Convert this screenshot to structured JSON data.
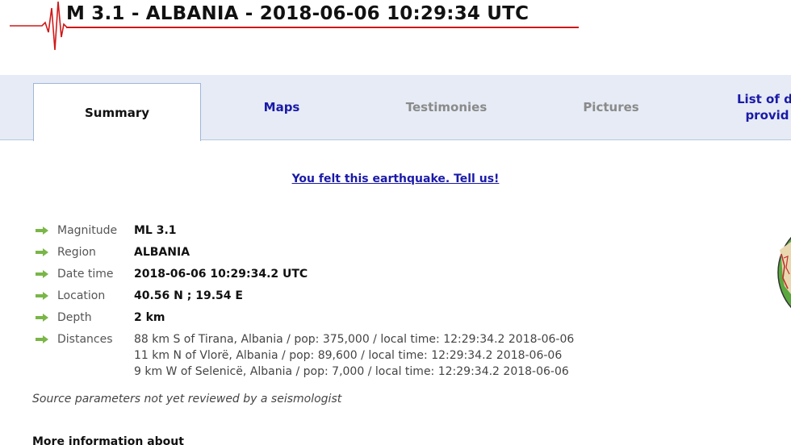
{
  "header": {
    "title": "M 3.1 - ALBANIA - 2018-06-06 10:29:34 UTC",
    "title_color": "#111111",
    "underline_color": "#d01818"
  },
  "tabs": [
    {
      "label": "Summary",
      "state": "active"
    },
    {
      "label": "Maps",
      "state": "link"
    },
    {
      "label": "Testimonies",
      "state": "disabled"
    },
    {
      "label": "Pictures",
      "state": "disabled"
    },
    {
      "label_line1": "List of d",
      "label_line2": "provid",
      "state": "link"
    }
  ],
  "feedback": {
    "label": "You felt this earthquake. Tell us!"
  },
  "details": {
    "magnitude": {
      "label": "Magnitude",
      "value": "ML 3.1"
    },
    "region": {
      "label": "Region",
      "value": "ALBANIA"
    },
    "datetime": {
      "label": "Date time",
      "value": "2018-06-06 10:29:34.2 UTC"
    },
    "location": {
      "label": "Location",
      "value": "40.56 N ; 19.54 E"
    },
    "depth": {
      "label": "Depth",
      "value": "2 km"
    },
    "distances": {
      "label": "Distances",
      "lines": [
        "88 km S of Tirana, Albania / pop: 375,000 / local time: 12:29:34.2 2018-06-06",
        "11 km N of Vlorë, Albania / pop: 89,600 / local time: 12:29:34.2 2018-06-06",
        "9 km W of Selenicë, Albania / pop: 7,000 / local time: 12:29:34.2 2018-06-06"
      ]
    }
  },
  "note": "Source parameters not yet reviewed by a seismologist",
  "more_heading": "More information about",
  "colors": {
    "tabbar_bg": "#e6ebf5",
    "link": "#1a1aa8",
    "muted": "#8a8a8a",
    "arrow": "#7ab648"
  },
  "icons": [
    "seismogram-logo-icon",
    "arrow-right-icon",
    "map-thumbnail"
  ]
}
